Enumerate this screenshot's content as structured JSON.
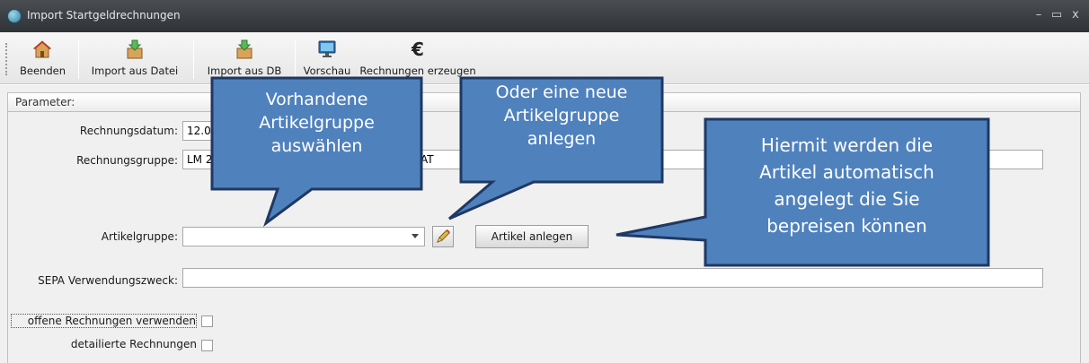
{
  "window": {
    "title": "Import Startgeldrechnungen",
    "minimize_glyph": "–",
    "maximize_glyph": "▭",
    "close_glyph": "x"
  },
  "toolbar": {
    "items": [
      {
        "label": "Beenden",
        "icon": "home-icon"
      },
      {
        "label": "Import aus Datei",
        "icon": "import-box-icon"
      },
      {
        "label": "Import aus DB",
        "icon": "import-db-icon"
      },
      {
        "label": "Vorschau",
        "icon": "monitor-icon"
      },
      {
        "label": "Rechnungen erzeugen",
        "icon": "euro-icon"
      }
    ]
  },
  "parameter": {
    "header": "Parameter:",
    "rechnungsdatum_label": "Rechnungsdatum:",
    "rechnungsdatum_value": "12.0",
    "rechnungsgruppe_label": "Rechnungsgruppe:",
    "rechnungsgruppe_value": "LM 2",
    "rechnungsgruppe_suffix": "AT",
    "artikelgruppe_label": "Artikelgruppe:",
    "artikelgruppe_value": "",
    "artikel_anlegen_label": "Artikel anlegen",
    "sepa_label": "SEPA Verwendungszweck:",
    "sepa_value": "",
    "offene_label": "offene Rechnungen verwenden",
    "detaillierte_label": "detailierte Rechnungen"
  },
  "callouts": {
    "vorhandene": [
      "Vorhandene",
      "Artikelgruppe",
      "auswählen"
    ],
    "neue": [
      "Oder eine neue",
      "Artikelgruppe",
      "anlegen"
    ],
    "hiermit": [
      "Hiermit werden die",
      "Artikel automatisch",
      "angelegt die Sie",
      "bepreisen können"
    ]
  },
  "colors": {
    "callout_fill": "#4f81bd",
    "callout_border": "#1f3864",
    "titlebar": "#3a3d42"
  }
}
